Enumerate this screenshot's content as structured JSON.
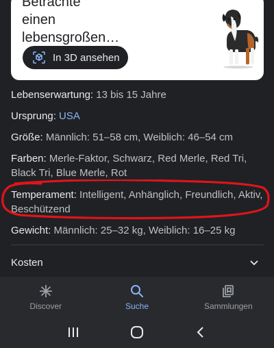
{
  "card": {
    "title": "Betrachte\neinen\nlebensgroßen…",
    "view3d_label": "In 3D ansehen"
  },
  "facts": [
    {
      "key": "Lebenserwartung:",
      "value": "13 bis 15 Jahre"
    },
    {
      "key": "Ursprung:",
      "value": "USA"
    },
    {
      "key": "Größe:",
      "value": "Männlich: 51–58 cm, Weiblich: 46–54 cm"
    },
    {
      "key": "Farben:",
      "value": "Merle-Faktor, Schwarz, Red Merle, Red Tri, Black Tri, Blue Merle, Rot"
    },
    {
      "key": "Temperament:",
      "value": "Intelligent, Anhänglich, Freundlich, Aktiv, Beschützend"
    },
    {
      "key": "Gewicht:",
      "value": "Männlich: 25–32 kg, Weiblich: 16–25 kg"
    }
  ],
  "kosten_label": "Kosten",
  "nav": [
    {
      "label": "Discover",
      "icon": "sparkle-icon"
    },
    {
      "label": "Suche",
      "icon": "search-icon"
    },
    {
      "label": "Sammlungen",
      "icon": "collections-icon"
    }
  ],
  "colors": {
    "background": "#202124",
    "link": "#8ab4f8",
    "annotation": "#e0141c",
    "active_nav": "#8ab4f8"
  }
}
